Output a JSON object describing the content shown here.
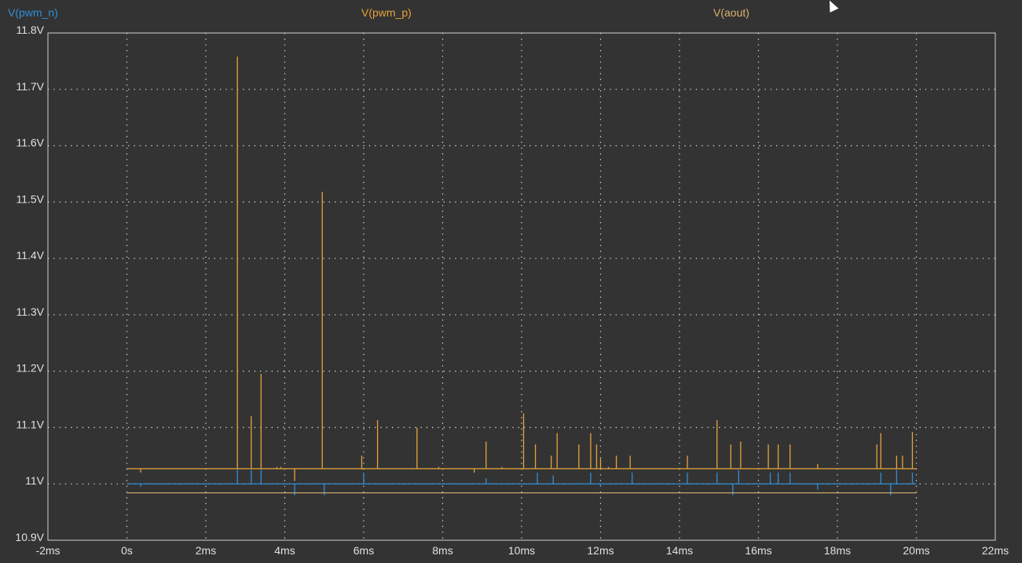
{
  "traces": [
    {
      "name": "V(pwm_n)",
      "color": "#2f8fd8"
    },
    {
      "name": "V(pwm_p)",
      "color": "#e8a33a"
    },
    {
      "name": "V(aout)",
      "color": "#d9b26a"
    }
  ],
  "chart_data": {
    "type": "line",
    "xlim": [
      -2,
      22
    ],
    "ylim": [
      10.9,
      11.8
    ],
    "x_ticks": [
      "-2ms",
      "0s",
      "2ms",
      "4ms",
      "6ms",
      "8ms",
      "10ms",
      "12ms",
      "14ms",
      "16ms",
      "18ms",
      "20ms",
      "22ms"
    ],
    "y_ticks": [
      "11.8V",
      "11.7V",
      "11.6V",
      "11.5V",
      "11.4V",
      "11.3V",
      "11.2V",
      "11.1V",
      "11V",
      "10.9V"
    ],
    "grid": true,
    "series": [
      {
        "name": "V(pwm_n)",
        "color": "#2f8fd8",
        "x_range": [
          0,
          20
        ],
        "baseline": 11.0,
        "spikes": [
          [
            0.35,
            10.995
          ],
          [
            2.8,
            11.025
          ],
          [
            3.15,
            11.025
          ],
          [
            3.4,
            11.025
          ],
          [
            4.25,
            10.98
          ],
          [
            5.0,
            10.98
          ],
          [
            6.0,
            11.02
          ],
          [
            6.4,
            11.0
          ],
          [
            7.4,
            11.0
          ],
          [
            9.1,
            11.01
          ],
          [
            10.05,
            11.0
          ],
          [
            10.4,
            11.02
          ],
          [
            10.8,
            11.015
          ],
          [
            11.75,
            11.02
          ],
          [
            12.0,
            10.995
          ],
          [
            12.8,
            11.02
          ],
          [
            14.2,
            11.02
          ],
          [
            14.95,
            11.02
          ],
          [
            15.35,
            10.98
          ],
          [
            15.5,
            11.025
          ],
          [
            16.3,
            11.02
          ],
          [
            16.5,
            11.02
          ],
          [
            16.8,
            11.02
          ],
          [
            17.5,
            10.99
          ],
          [
            19.1,
            11.02
          ],
          [
            19.35,
            10.98
          ],
          [
            19.5,
            11.025
          ],
          [
            19.9,
            11.02
          ]
        ]
      },
      {
        "name": "V(pwm_p)",
        "color": "#e8a33a",
        "x_range": [
          0,
          20
        ],
        "baseline": 11.027,
        "spikes": [
          [
            0.35,
            11.02
          ],
          [
            2.8,
            11.758
          ],
          [
            3.15,
            11.12
          ],
          [
            3.4,
            11.195
          ],
          [
            3.8,
            11.03
          ],
          [
            3.9,
            11.03
          ],
          [
            4.25,
            11.005
          ],
          [
            4.95,
            11.518
          ],
          [
            5.95,
            11.05
          ],
          [
            6.35,
            11.113
          ],
          [
            7.35,
            11.1
          ],
          [
            7.9,
            11.03
          ],
          [
            8.8,
            11.02
          ],
          [
            9.1,
            11.075
          ],
          [
            9.5,
            11.03
          ],
          [
            10.05,
            11.125
          ],
          [
            10.35,
            11.07
          ],
          [
            10.75,
            11.05
          ],
          [
            10.9,
            11.09
          ],
          [
            11.45,
            11.07
          ],
          [
            11.75,
            11.09
          ],
          [
            11.9,
            11.07
          ],
          [
            12.0,
            11.045
          ],
          [
            12.2,
            11.03
          ],
          [
            12.4,
            11.05
          ],
          [
            12.75,
            11.05
          ],
          [
            13.0,
            11.027
          ],
          [
            14.2,
            11.05
          ],
          [
            14.95,
            11.113
          ],
          [
            15.3,
            11.07
          ],
          [
            15.55,
            11.075
          ],
          [
            16.25,
            11.07
          ],
          [
            16.5,
            11.07
          ],
          [
            16.8,
            11.07
          ],
          [
            17.5,
            11.035
          ],
          [
            19.0,
            11.07
          ],
          [
            19.1,
            11.09
          ],
          [
            19.5,
            11.05
          ],
          [
            19.65,
            11.05
          ],
          [
            19.9,
            11.092
          ]
        ]
      },
      {
        "name": "V(aout)",
        "color": "#d9b26a",
        "x_range": [
          0,
          20
        ],
        "baseline": 10.984,
        "spikes": []
      }
    ]
  }
}
